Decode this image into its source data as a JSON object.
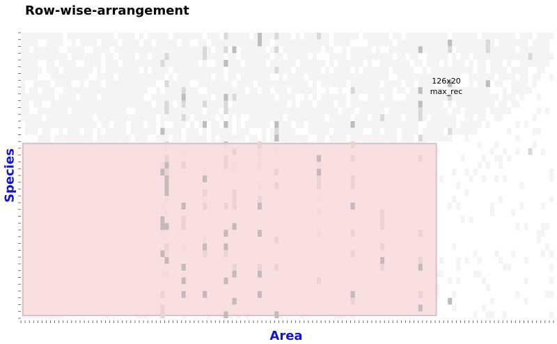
{
  "chart_data": {
    "type": "heatmap",
    "title": "Row-wise-arrangement",
    "xlabel": "Area",
    "ylabel": "Species",
    "grid": false,
    "legend": "none",
    "n_columns": 126,
    "n_rows": 42,
    "highlight": {
      "label_size": "126x20",
      "label_name": "max_rec",
      "row_start": 17,
      "row_end": 42,
      "col_start": 1,
      "col_end": 126
    },
    "cells": {
      "present_color": "#f4f4f4",
      "absent_color": "#ffffff",
      "highlight_color": "#f9dcdf",
      "highlight_border": "#d6c3c6",
      "dark_color": "#a9a9a9",
      "absence_row_profile": [
        0,
        0,
        0,
        0,
        1,
        2,
        3,
        4,
        5,
        6,
        8,
        10,
        12,
        15,
        18,
        24,
        30,
        36,
        38,
        40,
        42,
        44,
        46,
        48,
        50,
        52,
        54,
        58,
        62,
        66,
        70,
        74,
        78,
        82,
        86,
        90,
        94,
        98,
        102,
        106,
        110,
        116
      ],
      "mark_columns": [
        33,
        34,
        38,
        43,
        48,
        50,
        56,
        60,
        70,
        78,
        85,
        94,
        101,
        110,
        120
      ]
    }
  }
}
